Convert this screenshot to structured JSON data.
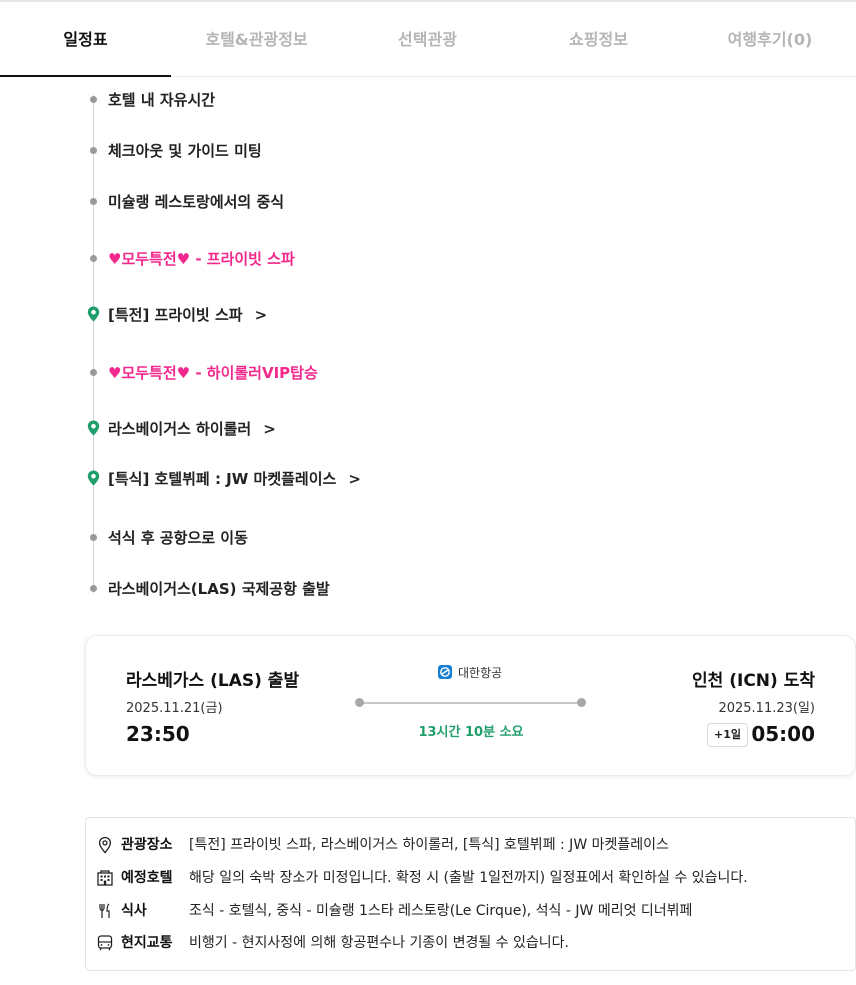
{
  "tabs": [
    {
      "label": "일정표",
      "active": true
    },
    {
      "label": "호텔&관광정보",
      "active": false
    },
    {
      "label": "선택관광",
      "active": false
    },
    {
      "label": "쇼핑정보",
      "active": false
    },
    {
      "label": "여행후기(0)",
      "active": false
    }
  ],
  "timeline": {
    "items": [
      {
        "text": "호텔 내 자유시간",
        "marker": "dot"
      },
      {
        "text": "체크아웃 및 가이드 미팅",
        "marker": "dot"
      },
      {
        "text": "미슐랭 레스토랑에서의 중식",
        "marker": "dot"
      },
      {
        "text": "♥모두특전♥ - 프라이빗 스파",
        "marker": "dot",
        "highlight": "#f2288c"
      },
      {
        "text": "[특전] 프라이빗 스파",
        "marker": "pin",
        "chevron": ">"
      },
      {
        "text": "♥모두특전♥ - 하이롤러VIP탑승",
        "marker": "dot",
        "highlight": "#f2288c"
      },
      {
        "text": "라스베이거스 하이롤러",
        "marker": "pin",
        "chevron": ">"
      },
      {
        "text": "[특식] 호텔뷔페 : JW 마켓플레이스",
        "marker": "pin",
        "chevron": ">"
      },
      {
        "text": "석식 후 공항으로 이동",
        "marker": "dot"
      },
      {
        "text": "라스베이거스(LAS) 국제공항 출발",
        "marker": "dot"
      }
    ]
  },
  "flight": {
    "departure": {
      "title": "라스베가스 (LAS) 출발",
      "date": "2025.11.21(금)",
      "time": "23:50"
    },
    "arrival": {
      "title": "인천 (ICN) 도착",
      "date": "2025.11.23(일)",
      "time": "05:00",
      "day_offset": "+1일"
    },
    "airline": "대한항공",
    "duration": "13시간 10분 소요"
  },
  "info": {
    "sightseeing": {
      "label": "관광장소",
      "value": "[특전] 프라이빗 스파, 라스베이거스 하이롤러, [특식] 호텔뷔페 : JW 마켓플레이스",
      "icon": "location-pin-icon"
    },
    "hotel": {
      "label": "예정호텔",
      "value": "해당 일의 숙박 장소가 미정입니다. 확정 시 (출발 1일전까지) 일정표에서 확인하실 수 있습니다.",
      "icon": "building-icon"
    },
    "meal": {
      "label": "식사",
      "value": "조식 - 호텔식, 중식 - 미슐랭 1스타 레스토랑(Le Cirque), 석식 - JW 메리엇 디너뷔페",
      "icon": "fork-knife-icon"
    },
    "transport": {
      "label": "현지교통",
      "value": "비행기 - 현지사정에 의해 항공편수나 기종이 변경될 수 있습니다.",
      "icon": "bus-icon"
    }
  },
  "colors": {
    "accent_green": "#1e9e6a",
    "highlight_pink": "#f2288c",
    "pin_green": "#1e9e6a",
    "airline_blue": "#1a7fd0"
  }
}
